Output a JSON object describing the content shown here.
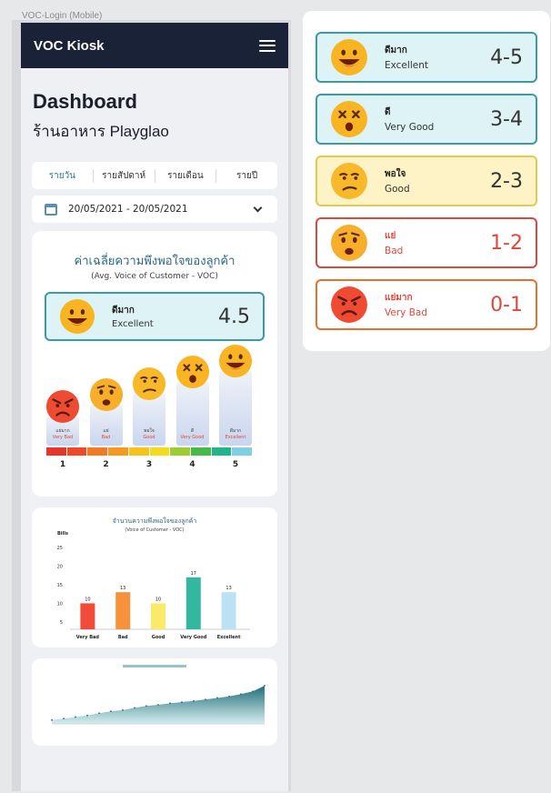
{
  "frame_label": "VOC-Login (Mobile)",
  "app": {
    "title": "VOC Kiosk"
  },
  "page": {
    "title": "Dashboard",
    "shop_name": "ร้านอาหาร Playglao"
  },
  "period_tabs": [
    "รายวัน",
    "รายสัปดาห์",
    "รายเดือน",
    "รายปี"
  ],
  "date_range": "20/05/2021 - 20/05/2021",
  "avg_card": {
    "title": "ค่าเฉลี่ยความพึงพอใจของลูกค้า",
    "subtitle": "(Avg. Voice of Customer - VOC)",
    "label_th": "ดีมาก",
    "label_en": "Excellent",
    "score": "4.5"
  },
  "scale_items": [
    {
      "th": "แย่มาก",
      "en": "Very Bad",
      "num": "1",
      "mood": "angry",
      "level": 0.2
    },
    {
      "th": "แย่",
      "en": "Bad",
      "num": "2",
      "mood": "worried",
      "level": 0.4
    },
    {
      "th": "พอใจ",
      "en": "Good",
      "num": "3",
      "mood": "meh",
      "level": 0.6
    },
    {
      "th": "ดี",
      "en": "Very Good",
      "num": "4",
      "mood": "dizzy",
      "level": 0.8
    },
    {
      "th": "ดีมาก",
      "en": "Excellent",
      "num": "5",
      "mood": "happy",
      "level": 1.0
    }
  ],
  "scale_colors": [
    "#e8352a",
    "#ee4a2a",
    "#f07a26",
    "#f59a1f",
    "#f7c21b",
    "#f4dc1d",
    "#9ccf2e",
    "#47b94a",
    "#20b58c",
    "#7fd0e6"
  ],
  "chart_data": {
    "type": "bar",
    "title": "จำนวนความพึงพอใจของลูกค้า",
    "subtitle": "(Voice of Customer - VOC)",
    "ylabel": "Bills",
    "categories": [
      "Very Bad",
      "Bad",
      "Good",
      "Very Good",
      "Excellent"
    ],
    "values": [
      10,
      13,
      10,
      17,
      13
    ],
    "yticks": [
      5,
      10,
      15,
      20,
      25
    ],
    "ylim": [
      3,
      27
    ],
    "colors": [
      "#f24b3a",
      "#f5923a",
      "#f9ea6a",
      "#33b8a0",
      "#b9e2f3"
    ]
  },
  "legend": [
    {
      "th": "ดีมาก",
      "en": "Excellent",
      "range": "4-5",
      "mood": "happy",
      "border": "#3a9aa8",
      "bg": "#ddf3f6",
      "text": "#333333",
      "th_color": "#222222",
      "en_color": "#333333"
    },
    {
      "th": "ดี",
      "en": "Very Good",
      "range": "3-4",
      "mood": "dizzy",
      "border": "#3a9aa8",
      "bg": "#ddf3f6",
      "text": "#333333",
      "th_color": "#222222",
      "en_color": "#333333"
    },
    {
      "th": "พอใจ",
      "en": "Good",
      "range": "2-3",
      "mood": "meh",
      "border": "#e7c84d",
      "bg": "#fdf3c6",
      "text": "#333333",
      "th_color": "#222222",
      "en_color": "#333333"
    },
    {
      "th": "แย่",
      "en": "Bad",
      "range": "1-2",
      "mood": "worried",
      "border": "#e0463a",
      "bg": "#ffffff",
      "text": "#e0463a",
      "th_color": "#e0463a",
      "en_color": "#e0463a"
    },
    {
      "th": "แย่มาก",
      "en": "Very Bad",
      "range": "0-1",
      "mood": "angry",
      "border": "#e8702a",
      "bg": "#ffffff",
      "text": "#e0463a",
      "th_color": "#e0463a",
      "en_color": "#e0463a"
    }
  ]
}
